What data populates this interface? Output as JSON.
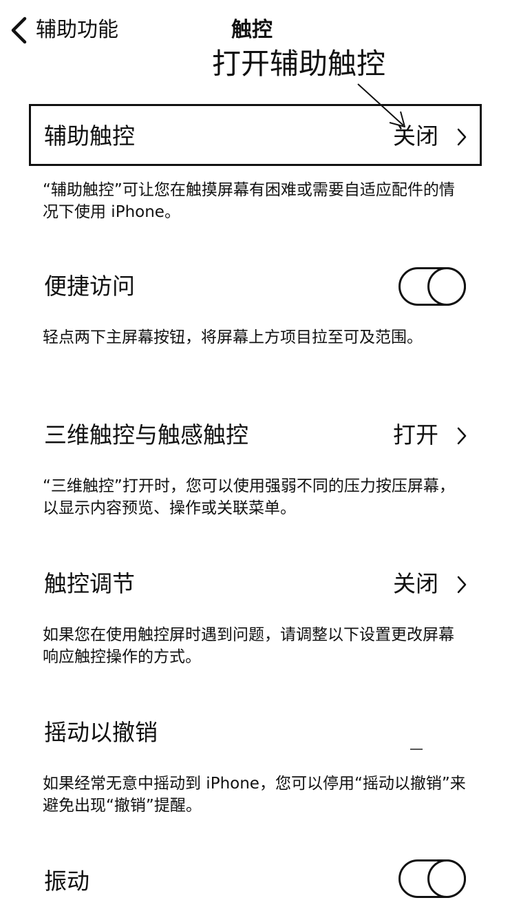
{
  "nav": {
    "back_label": "辅助功能",
    "title": "触控"
  },
  "annotation": {
    "text": "打开辅助触控"
  },
  "rows": [
    {
      "label": "辅助触控",
      "value": "关闭",
      "desc": "“辅助触控”可让您在触摸屏幕有困难或需要自适应配件的情况下使用 iPhone。"
    },
    {
      "label": "便捷访问",
      "toggle": "off",
      "desc": "轻点两下主屏幕按钮，将屏幕上方项目拉至可及范围。"
    },
    {
      "label": "三维触控与触感触控",
      "value": "打开",
      "desc": "“三维触控”打开时，您可以使用强弱不同的压力按压屏幕，以显示内容预览、操作或关联菜单。"
    },
    {
      "label": "触控调节",
      "value": "关闭",
      "desc": "如果您在使用触控屏时遇到问题，请调整以下设置更改屏幕响应触控操作的方式。"
    },
    {
      "label": "摇动以撤销",
      "desc": "如果经常无意中摇动到 iPhone，您可以停用“摇动以撤销”来避免出现“撤销”提醒。"
    },
    {
      "label": "振动",
      "toggle": "off"
    }
  ],
  "icons": {
    "back": "chevron-left-icon",
    "disclosure": "chevron-right-icon"
  }
}
